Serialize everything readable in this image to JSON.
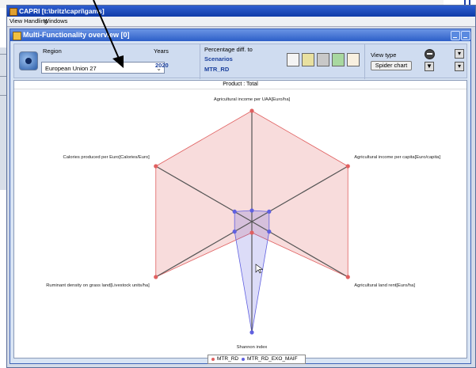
{
  "app": {
    "title": "CAPRI [t:\\britz\\capri\\gams]",
    "menu": [
      "View Handling",
      "Windows"
    ]
  },
  "window": {
    "title": "Multi-Functionality overview [0]"
  },
  "toolbar": {
    "region_label": "Region",
    "region_value": "European Union 27",
    "years_label": "Years",
    "years_value": "2020",
    "pct_label": "Percentage diff. to",
    "scenarios_label": "Scenarios",
    "scenario_value": "MTR_RD",
    "view_type_label": "View type",
    "view_type_value": "Spider chart"
  },
  "chart_data": {
    "type": "radar",
    "title": "Product : Total",
    "axes": [
      "Agricultural income per UAA[Euro/ha]",
      "Agricultural income per capita[Euro/capita]",
      "Agricultural land rent[Euro/ha]",
      "Shannon index",
      "Ruminant density on grass land[Livestock units/ha]",
      "Calories produced per Euro[Calories/Euro]"
    ],
    "series": [
      {
        "name": "MTR_RD",
        "color": "#e06060",
        "values": [
          1,
          1,
          1,
          0.1,
          1,
          1
        ]
      },
      {
        "name": "MTR_RD_EXO_MAIF",
        "color": "#6060e0",
        "values": [
          0.1,
          0.18,
          0.18,
          1,
          0.18,
          0.18
        ]
      }
    ]
  },
  "colors": {
    "title_bar": "#0f3aa8",
    "inner_title_bar": "#2d5fc8",
    "panel_bg": "#d8e4f4"
  }
}
